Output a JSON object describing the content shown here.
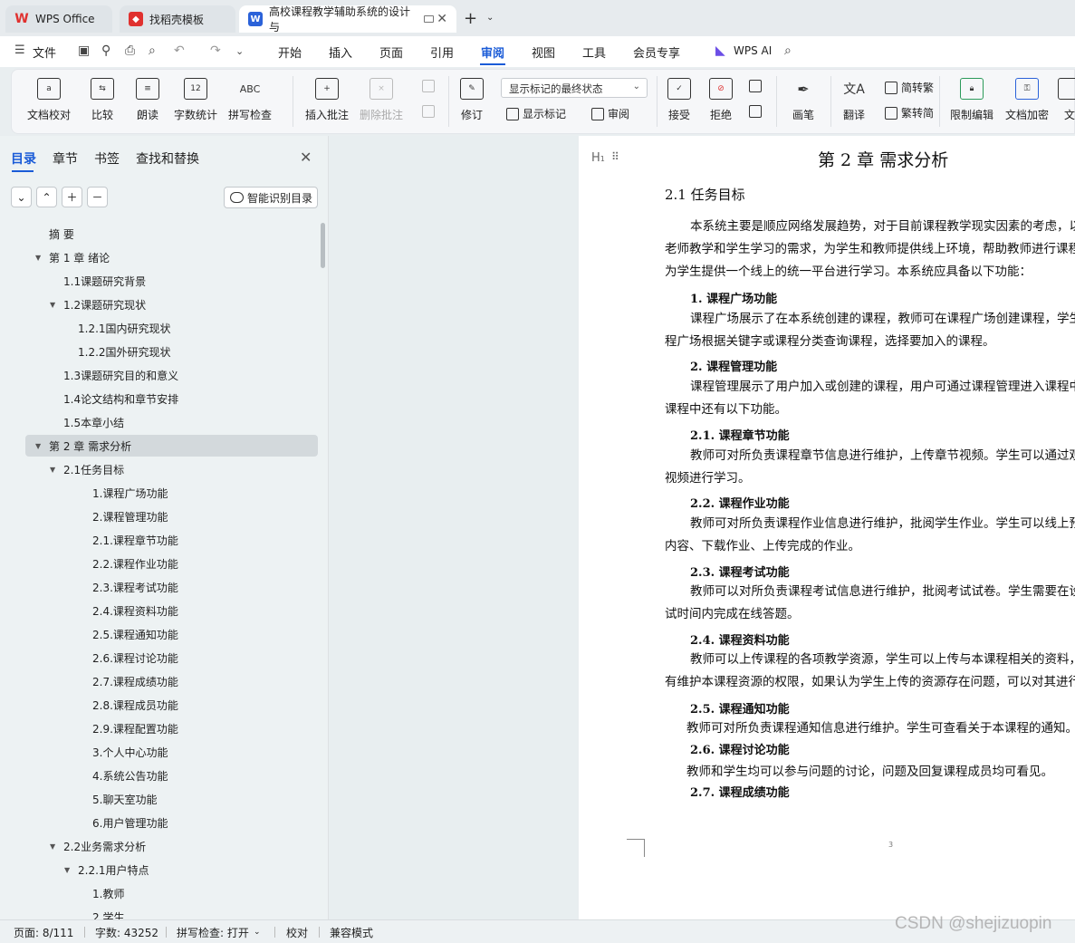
{
  "tabs": [
    {
      "label": "WPS Office",
      "icon": "wps-logo-icon"
    },
    {
      "label": "找稻壳模板",
      "icon": "docer-icon"
    },
    {
      "label": "高校课程教学辅助系统的设计与",
      "icon": "word-doc-icon"
    }
  ],
  "menu": {
    "file": "文件",
    "items": [
      "开始",
      "插入",
      "页面",
      "引用",
      "审阅",
      "视图",
      "工具",
      "会员专享"
    ],
    "active": "审阅",
    "ai": "WPS AI"
  },
  "ribbon": {
    "doc_check": "文档校对",
    "compare": "比较",
    "read_aloud": "朗读",
    "word_count": "字数统计",
    "spell_check": "拼写检查",
    "insert_comment": "插入批注",
    "delete_comment": "删除批注",
    "revise": "修订",
    "display_select": "显示标记的最终状态",
    "show_markup": "显示标记",
    "review": "审阅",
    "accept": "接受",
    "reject": "拒绝",
    "pen": "画笔",
    "translate": "翻译",
    "to_traditional": "简转繁",
    "to_simplified": "繁转简",
    "restrict_edit": "限制编辑",
    "encrypt": "文档加密",
    "more": "文"
  },
  "panel": {
    "tabs": [
      "目录",
      "章节",
      "书签",
      "查找和替换"
    ],
    "smart_toc": "智能识别目录",
    "toc": [
      {
        "label": "摘  要",
        "level": 1,
        "arrow": ""
      },
      {
        "label": "第 1 章  绪论",
        "level": 1,
        "arrow": "▼"
      },
      {
        "label": "1.1课题研究背景",
        "level": 2,
        "arrow": ""
      },
      {
        "label": "1.2课题研究现状",
        "level": 2,
        "arrow": "▼"
      },
      {
        "label": "1.2.1国内研究现状",
        "level": 3,
        "arrow": ""
      },
      {
        "label": "1.2.2国外研究现状",
        "level": 3,
        "arrow": ""
      },
      {
        "label": "1.3课题研究目的和意义",
        "level": 2,
        "arrow": ""
      },
      {
        "label": "1.4论文结构和章节安排",
        "level": 2,
        "arrow": ""
      },
      {
        "label": "1.5本章小结",
        "level": 2,
        "arrow": ""
      },
      {
        "label": "第 2 章  需求分析",
        "level": 1,
        "arrow": "▼",
        "selected": true
      },
      {
        "label": "2.1任务目标",
        "level": 2,
        "arrow": "▼"
      },
      {
        "label": "1.课程广场功能",
        "level": 4,
        "arrow": ""
      },
      {
        "label": "2.课程管理功能",
        "level": 4,
        "arrow": ""
      },
      {
        "label": "2.1.课程章节功能",
        "level": 4,
        "arrow": ""
      },
      {
        "label": "2.2.课程作业功能",
        "level": 4,
        "arrow": ""
      },
      {
        "label": "2.3.课程考试功能",
        "level": 4,
        "arrow": ""
      },
      {
        "label": "2.4.课程资料功能",
        "level": 4,
        "arrow": ""
      },
      {
        "label": "2.5.课程通知功能",
        "level": 4,
        "arrow": ""
      },
      {
        "label": "2.6.课程讨论功能",
        "level": 4,
        "arrow": ""
      },
      {
        "label": "2.7.课程成绩功能",
        "level": 4,
        "arrow": ""
      },
      {
        "label": "2.8.课程成员功能",
        "level": 4,
        "arrow": ""
      },
      {
        "label": "2.9.课程配置功能",
        "level": 4,
        "arrow": ""
      },
      {
        "label": "3.个人中心功能",
        "level": 4,
        "arrow": ""
      },
      {
        "label": "4.系统公告功能",
        "level": 4,
        "arrow": ""
      },
      {
        "label": "5.聊天室功能",
        "level": 4,
        "arrow": ""
      },
      {
        "label": "6.用户管理功能",
        "level": 4,
        "arrow": ""
      },
      {
        "label": "2.2业务需求分析",
        "level": 2,
        "arrow": "▼"
      },
      {
        "label": "2.2.1用户特点",
        "level": 3,
        "arrow": "▼"
      },
      {
        "label": "1.教师",
        "level": 4,
        "arrow": ""
      },
      {
        "label": "2.学生",
        "level": 4,
        "arrow": ""
      }
    ]
  },
  "document": {
    "chapter_title": "第 2 章    需求分析",
    "section_title": "2.1  任务目标",
    "lines": [
      {
        "text": "本系统主要是顺应网络发展趋势，对于目前课程教学现实因素的考虑，以",
        "kind": "body",
        "indent": true
      },
      {
        "text": "老师教学和学生学习的需求，为学生和教师提供线上环境，帮助教师进行课程",
        "kind": "body",
        "indent": false
      },
      {
        "text": "为学生提供一个线上的统一平台进行学习。本系统应具备以下功能：",
        "kind": "body",
        "indent": false
      },
      {
        "text": "1. 课程广场功能",
        "kind": "sub"
      },
      {
        "text": "课程广场展示了在本系统创建的课程，教师可在课程广场创建课程，学生",
        "kind": "body",
        "indent": true
      },
      {
        "text": "程广场根据关键字或课程分类查询课程，选择要加入的课程。",
        "kind": "body",
        "indent": false
      },
      {
        "text": "2. 课程管理功能",
        "kind": "sub"
      },
      {
        "text": "课程管理展示了用户加入或创建的课程，用户可通过课程管理进入课程中",
        "kind": "body",
        "indent": true
      },
      {
        "text": "课程中还有以下功能。",
        "kind": "body",
        "indent": false
      },
      {
        "text": "2.1. 课程章节功能",
        "kind": "sub"
      },
      {
        "text": "教师可对所负责课程章节信息进行维护，上传章节视频。学生可以通过观",
        "kind": "body",
        "indent": true
      },
      {
        "text": "视频进行学习。",
        "kind": "body",
        "indent": false
      },
      {
        "text": "2.2. 课程作业功能",
        "kind": "sub"
      },
      {
        "text": "教师可对所负责课程作业信息进行维护，批阅学生作业。学生可以线上预",
        "kind": "body",
        "indent": true
      },
      {
        "text": "内容、下载作业、上传完成的作业。",
        "kind": "body",
        "indent": false
      },
      {
        "text": "2.3. 课程考试功能",
        "kind": "sub"
      },
      {
        "text": "教师可以对所负责课程考试信息进行维护，批阅考试试卷。学生需要在设",
        "kind": "body",
        "indent": true
      },
      {
        "text": "试时间内完成在线答题。",
        "kind": "body",
        "indent": false
      },
      {
        "text": "2.4. 课程资料功能",
        "kind": "sub"
      },
      {
        "text": "教师可以上传课程的各项教学资源，学生可以上传与本课程相关的资料，",
        "kind": "body",
        "indent": true
      },
      {
        "text": "有维护本课程资源的权限，如果认为学生上传的资源存在问题，可以对其进行",
        "kind": "body",
        "indent": false
      },
      {
        "text": "2.5. 课程通知功能",
        "kind": "sub"
      },
      {
        "text": "教师可对所负责课程通知信息进行维护。学生可查看关于本课程的通知。",
        "kind": "body2"
      },
      {
        "text": "2.6. 课程讨论功能",
        "kind": "sub"
      },
      {
        "text": "教师和学生均可以参与问题的讨论，问题及回复课程成员均可看见。",
        "kind": "body2"
      },
      {
        "text": "2.7. 课程成绩功能",
        "kind": "sub"
      }
    ],
    "page_number": "3"
  },
  "status": {
    "page": "页面: 8/111",
    "words": "字数: 43252",
    "spell": "拼写检查: 打开",
    "proof": "校对",
    "compat": "兼容模式"
  },
  "watermark": "CSDN @shejizuopin",
  "colors": {
    "accent": "#1a5bd7",
    "wps_red": "#e0312f"
  }
}
